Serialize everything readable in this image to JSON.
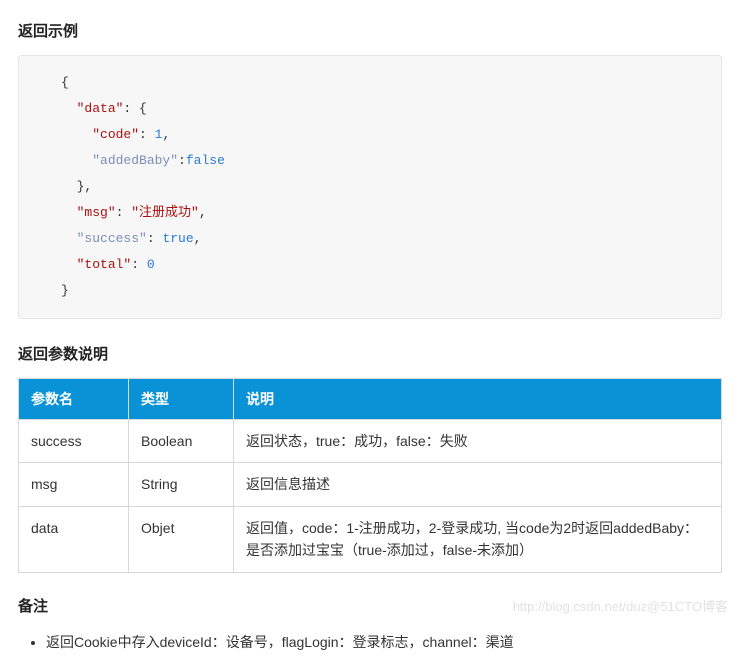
{
  "sections": {
    "example_title": "返回示例",
    "params_title": "返回参数说明",
    "remark_title": "备注"
  },
  "code": {
    "l1": "{",
    "l2_key": "\"data\"",
    "l2_after": ": {",
    "l3_key": "\"code\"",
    "l3_val": "1",
    "l4_key": "\"addedBaby\"",
    "l4_val": "false",
    "l5": "},",
    "l6_key": "\"msg\"",
    "l6_val": "\"注册成功\"",
    "l7_key": "\"success\"",
    "l7_val": "true",
    "l8_key": "\"total\"",
    "l8_val": "0",
    "l9": "}"
  },
  "table": {
    "headers": {
      "name": "参数名",
      "type": "类型",
      "desc": "说明"
    },
    "rows": [
      {
        "name": "success",
        "type": "Boolean",
        "desc": "返回状态，true：成功，false：失败"
      },
      {
        "name": "msg",
        "type": "String",
        "desc": "返回信息描述"
      },
      {
        "name": "data",
        "type": "Objet",
        "desc": "返回值，code：1-注册成功，2-登录成功, 当code为2时返回addedBaby：是否添加过宝宝（true-添加过，false-未添加）"
      }
    ]
  },
  "remarks": [
    "返回Cookie中存入deviceId：设备号，flagLogin：登录标志，channel：渠道"
  ],
  "watermark": "http://blog.csdn.net/duz@51CTO博客"
}
